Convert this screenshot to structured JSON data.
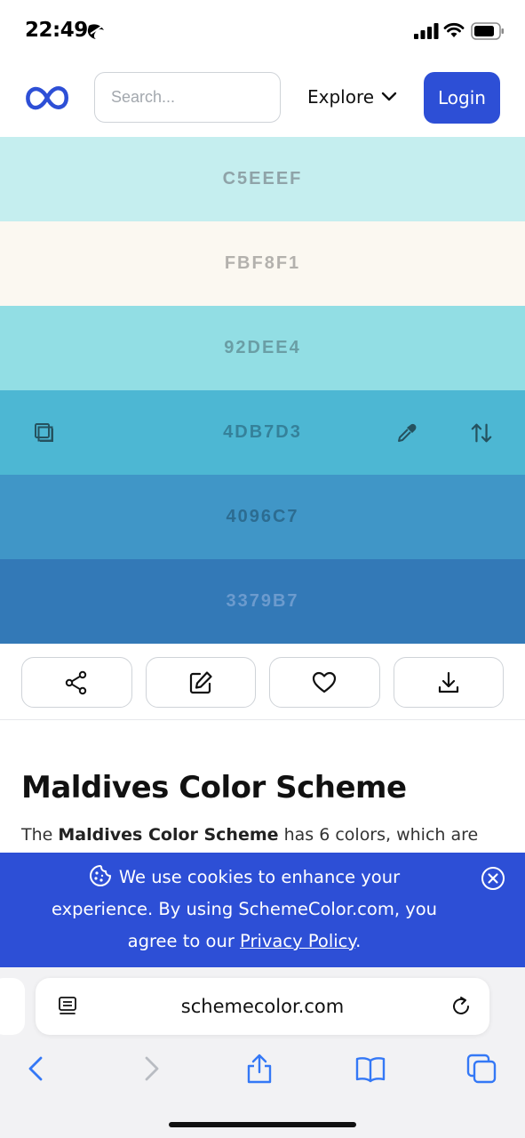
{
  "status_bar": {
    "time": "22:49"
  },
  "header": {
    "search_placeholder": "Search...",
    "explore_label": "Explore",
    "login_label": "Login"
  },
  "palette": [
    {
      "hex": "C5EEEF",
      "bg": "#C5EEEF",
      "text_color": "#8fa3a8"
    },
    {
      "hex": "FBF8F1",
      "bg": "#FBF8F1",
      "text_color": "#b3b1ad"
    },
    {
      "hex": "92DEE4",
      "bg": "#92DEE4",
      "text_color": "#6a9ea5"
    },
    {
      "hex": "4DB7D3",
      "bg": "#4DB7D3",
      "text_color": "#35819a"
    },
    {
      "hex": "4096C7",
      "bg": "#4096C7",
      "text_color": "#2c6c91"
    },
    {
      "hex": "3379B7",
      "bg": "#3379B7",
      "text_color": "#6c9bce"
    }
  ],
  "actions": [
    {
      "icon": "share-icon"
    },
    {
      "icon": "edit-icon"
    },
    {
      "icon": "heart-icon"
    },
    {
      "icon": "download-icon"
    }
  ],
  "content": {
    "title": "Maldives Color Scheme",
    "desc_prefix": "The ",
    "desc_bold": "Maldives Color Scheme",
    "desc_suffix": " has 6 colors, which are"
  },
  "cookie": {
    "line1": "We use cookies to enhance your",
    "line2": "experience. By using SchemeColor.com, you",
    "line3_prefix": "agree to our ",
    "link": "Privacy Policy",
    "line3_suffix": "."
  },
  "browser": {
    "url": "schemecolor.com"
  },
  "colors": {
    "accent": "#2d4fd6",
    "icon_dark": "#25525f",
    "safari_blue": "#3478f6"
  }
}
